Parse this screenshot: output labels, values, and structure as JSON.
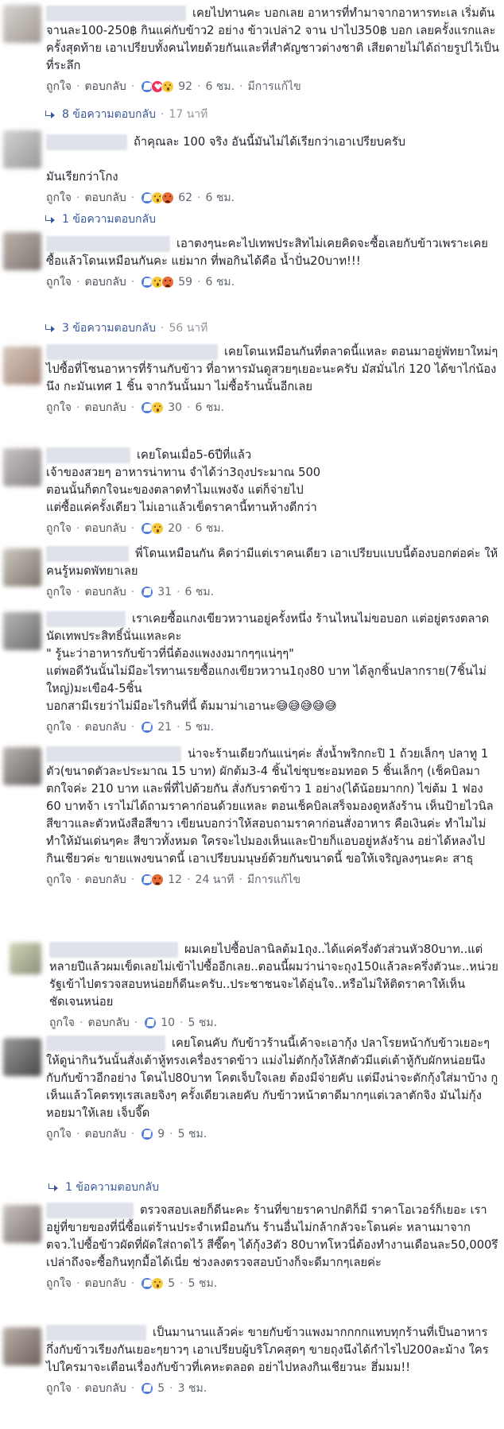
{
  "labels": {
    "like": "ถูกใจ",
    "reply": "ตอบกลับ",
    "edited": "มีการแก้ไข",
    "sep": "·"
  },
  "comments": [
    {
      "text": "เคยไปทานคะ บอกเลย อาหารที่ทำมาจากอาหารทะเล เริ่มต้น จานละ100-250฿ กินแค่กับข้าว2 อย่าง ข้าวเปล่า2 จาน ปาไป350฿ บอก เลยครั้งแรกและครั้งสุดท้าย เอาเปรียบทั้งคนไทยด้วยกันและที่สำคัญชาวต่างชาติ เสียดายไม่ได้ถ่ายรูปไว้เป็นที่ระลึก",
      "reactions": [
        "like",
        "love",
        "wow"
      ],
      "count": "92",
      "time": "6 ชม.",
      "edited": true,
      "replies": "8 ข้อความตอบกลับ",
      "replies_time": "17 นาที"
    },
    {
      "text": "ถ้าคุณละ 100 จริง อันนี้มันไม่ได้เรียกว่าเอาเปรียบครับ\n\nมันเรียกว่าโกง",
      "reactions": [
        "like",
        "wow",
        "angry"
      ],
      "count": "62",
      "time": "6 ชม.",
      "edited": false,
      "replies": "1 ข้อความตอบกลับ",
      "replies_time": ""
    },
    {
      "text": "เอาตงๆนะคะไปเทพประสิทไม่เคยคิดจะซื้อเลยกับข้าวเพราะเคยซื้อแล้วโดนเหมือนกันคะ แย่มาก ที่พอกินได้คือ น้ำปั่น20บาท!!!",
      "reactions": [
        "like",
        "wow",
        "angry"
      ],
      "count": "59",
      "time": "6 ชม.",
      "edited": false,
      "replies": "3 ข้อความตอบกลับ",
      "replies_time": "56 นาที"
    },
    {
      "text": "เคยโดนเหมือนกันที่ตลาดนี้แหละ ตอนมาอยู่พัทยาใหม่ๆ ไปซื้อที่โซนอาหารที่ร้านกับข้าว ที่อาหารมันดูสวยๆเยอะนะครับ มัสมั่นไก่ 120 ได้ขาไก่น้องนึง กะมันเทศ 1 ชิ้น จากวันนั้นมา ไม่ซื้อร้านนั้นอีกเลย",
      "reactions": [
        "like",
        "wow"
      ],
      "count": "30",
      "time": "6 ชม.",
      "edited": false,
      "replies": "",
      "replies_time": ""
    },
    {
      "text": "เคยโดนเมื่อ5-6ปีที่แล้ว\nเจ้าของสวยๆ อาหารน่าทาน จำได้ว่า3ถุงประมาณ 500\nตอนนั้นก็ตกใจนะของตลาดทำไมแพงจัง แต่ก็จ่ายไป\nแต่ซื้อแค่ครั้งเดียว ไม่เอาแล้วเข็ดราคานี้ทานห้างดีกว่า",
      "reactions": [
        "like",
        "wow"
      ],
      "count": "20",
      "time": "6 ชม.",
      "edited": false,
      "replies": "",
      "replies_time": ""
    },
    {
      "text": "พี่โดนเหมือนกัน คิดว่ามีแต่เราคนเดียว เอาเปรียบแบบนี้ต้องบอกต่อค่ะ ให้คนรู้หมดพัทยาเลย",
      "reactions": [
        "like"
      ],
      "count": "31",
      "time": "6 ชม.",
      "edited": false,
      "replies": "",
      "replies_time": ""
    },
    {
      "text": "เราเคยซื้อแกงเขียวหวานอยู่ครั้งหนึ่ง ร้านไหนไม่ขอบอก แต่อยู่ตรงตลาดนัดเทพประสิทธิ์นั่นแหละคะ\n\" รู้นะว่าอาหารกับข้าวที่นี่ต้องแพงงงมากๆๆแน่ๆๆ\"\nแต่พอดีวันนั้นไม่มีอะไรทานเรยซื้อแกงเขียวหวาน1ถุง80 บาท ได้ลูกชิ้นปลากราย(7ชิ้นไม่ใหญ่)มะเขือ4-5ชิ้น\nบอกสามีเรยว่าไม่มีอะไรกินที่นี้ ต้มมาม่าเอานะ😅😅😅😅😅",
      "reactions": [
        "like"
      ],
      "count": "21",
      "time": "5 ชม.",
      "edited": false,
      "replies": "",
      "replies_time": ""
    },
    {
      "text": "น่าจะร้านเดียวกันแน่ๆค่ะ สั่งน้ำพริกกะปิ 1 ถ้วยเล็กๆ ปลาทู 1 ตัว(ขนาดตัวละประมาณ 15 บาท) ผักต้ม3-4 ชิ้นไข่ชุบชะอมทอด 5 ชิ้นเล็กๆ (เช็คบิลมาตกใจค่ะ 210 บาท และพี่ที่ไปด้วยกัน สั่งกับราดข้าว 1 อย่าง(ได้น้อยมากก) ไข่ต้ม 1 ฟอง 60 บาทจ้า เราไม่ได้ถามราคาก่อนด้วยแหละ ตอนเช็คบิลเสร็จมองดูหลังร้าน เห็นป้ายไวนิลสีขาวและตัวหนังสือสีขาว เขียนบอกว่าให้สอบถามราคาก่อนสั่งอาหาร คือเงินค่ะ ทำไมไม่ทำให้มันเด่นๆคะ สีขาวทั้งหมด ใครจะไปมองเห็นและป้ายก็แอบอยู่หลังร้าน อย่าได้หลงไปกินเชียวค่ะ ขายแพงขนาดนี้ เอาเปรียบมนุษย์ด้วยกันขนาดนี้ ขอให้เจริญลงๆนะคะ สาธุ",
      "reactions": [
        "like",
        "angry"
      ],
      "count": "12",
      "time": "24 นาที",
      "edited": true,
      "replies": "",
      "replies_time": ""
    },
    {
      "text": "ผมเคยไปซื้อปลานิลต้ม1ถุง..ได้แค่ครึ่งตัวส่วนหัว80บาท..แต่หลายปีแล้วผมเข็ดเลยไม่เข้าไปซื้ออีกเลย..ตอนนี้ผมว่าน่าจะถุง150แล้วละครึ่งตัวนะ..หน่วยรัฐเข้าไปตรวจสอบหน่อยก็ดีนะครับ..ประชาชนจะได้อุ่นใจ..หรือไม่ให้ติดราคาให้เห็นชัดเจนหน่อย",
      "reactions": [
        "like"
      ],
      "count": "10",
      "time": "5 ชม.",
      "edited": false,
      "replies": "",
      "replies_time": ""
    },
    {
      "text": "เคยโดนคับ กับข้าวร้านนี้เค้าจะเอากุ้ง ปลาโรยหน้ากับข้าวเยอะๆให้ดูน่ากินวันนั้นสั่งเต้าหู้ทรงเครื่องราดข้าว แม่งไม่ตักกุ้งให้สักตัวมีแต่เต้าหู้กับผักหน่อยนึง กับกับข้าวอีกอย่าง โดนไป80บาท โคตเจ็บใจเลย ต้องมีจ่ายคับ แต่มึงน่าจะตักกุ้งใส่มาบ้าง กูเห็นแล้วโคตรทุเรสเลยจิงๆ ครั้งเดียวเลยคับ กับข้าวหน้าตาดีมากๆแต่เวลาตักจิง มันไม่กุ้งหอยมาให้เลย เจ็บจี๊ด",
      "reactions": [
        "like"
      ],
      "count": "9",
      "time": "5 ชม.",
      "edited": false,
      "replies": "1 ข้อความตอบกลับ",
      "replies_time": ""
    },
    {
      "text": "ตรวจสอบเลยก็ดีนะคะ ร้านที่ขายราคาปกติก็มี ราคาโอเวอร์ก็เยอะ เราอยู่ที่ขายของที่นี่ซื้อแต่ร้านประจำเหมือนกัน ร้านอื่นไม่กล้ากลัวจะโดนค่ะ หลานมาจากตจว.ไปซื้อข้าวผัดที่ผัดใส่ถาดไว้ สีซี๊ดๆ ได้กุ้ง3ตัว 80บาทโหวนี่ต้องทำงานเดือนละ50,000รึเปล่าถึงจะซื้อกินทุกมื้อได้เนี่ย ช่วงลงตรวจสอบบ้างก็จะดีมากๆเลยค่ะ",
      "reactions": [
        "like",
        "wow"
      ],
      "count": "5",
      "time": "5 ชม.",
      "edited": false,
      "replies": "",
      "replies_time": ""
    },
    {
      "text": "เป็นมานานแล้วค่ะ ขายกับข้าวแพงมากกกกแทบทุกร้านที่เป็นอาหารกึ่งกับข้าวเรียงกันเยอะๆยาวๆ เอาเปรียบผู้บริโภคสุดๆ ขายถุงนึงได้กำไรไป200ละม้าง ใครไปใครมาจะเตือนเรื่องกับข้าวที่เคหะตลอด อย่าไปหลงกินเชียวนะ ฮึ่มมม!!",
      "reactions": [
        "like"
      ],
      "count": "5",
      "time": "3 ชม.",
      "edited": false,
      "replies": "",
      "replies_time": ""
    }
  ]
}
